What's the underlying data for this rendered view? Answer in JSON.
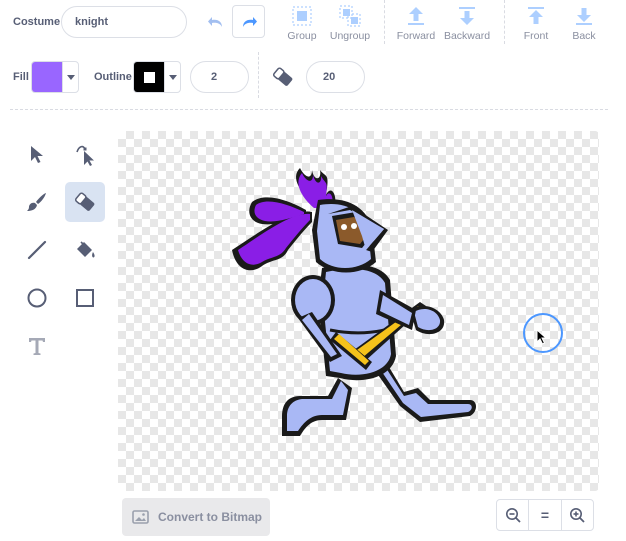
{
  "header": {
    "costume_label": "Costume",
    "costume_name": "knight"
  },
  "toolbar": {
    "group_label": "Group",
    "ungroup_label": "Ungroup",
    "forward_label": "Forward",
    "backward_label": "Backward",
    "front_label": "Front",
    "back_label": "Back"
  },
  "style_row": {
    "fill_label": "Fill",
    "fill_color": "#9966ff",
    "outline_label": "Outline",
    "outline_color": "#000000",
    "outline_width": "2",
    "eraser_size": "20"
  },
  "tools": [
    {
      "name": "select",
      "icon": "arrow-icon",
      "active": false
    },
    {
      "name": "reshape",
      "icon": "reshape-icon",
      "active": false
    },
    {
      "name": "brush",
      "icon": "brush-icon",
      "active": false
    },
    {
      "name": "eraser",
      "icon": "eraser-icon",
      "active": true
    },
    {
      "name": "line",
      "icon": "line-icon",
      "active": false
    },
    {
      "name": "fill",
      "icon": "bucket-icon",
      "active": false
    },
    {
      "name": "circle",
      "icon": "circle-icon",
      "active": false
    },
    {
      "name": "rectangle",
      "icon": "square-icon",
      "active": false
    },
    {
      "name": "text",
      "icon": "text-icon",
      "active": false
    }
  ],
  "footer": {
    "convert_label": "Convert to Bitmap",
    "zoom_reset_label": "="
  },
  "colors": {
    "accent": "#4c97ff",
    "active_tool_bg": "#d9e3f2",
    "plume": "#8a1ee6",
    "armor": "#a9b8f5",
    "sword": "#f5c21b"
  }
}
